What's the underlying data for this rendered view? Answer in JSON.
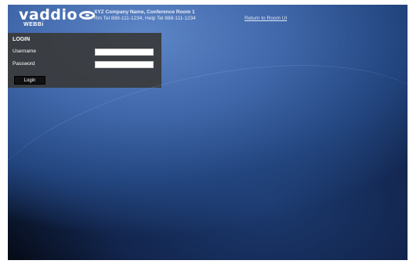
{
  "header": {
    "logo_text": "vaddio",
    "logo_sub": "WEBBi",
    "company_line": "XYZ Company Name, Conference Room 1",
    "phone_line": "Rm Tel 888-111-1234, Help Tel 888-111-1234",
    "return_link": "Return to Room UI"
  },
  "login": {
    "title": "LOGIN",
    "username_label": "Username",
    "password_label": "Password",
    "username_value": "",
    "password_value": "",
    "button_label": "Login"
  },
  "colors": {
    "background_accent": "#3f66a8",
    "panel": "#3a3a3a",
    "button": "#111111"
  }
}
